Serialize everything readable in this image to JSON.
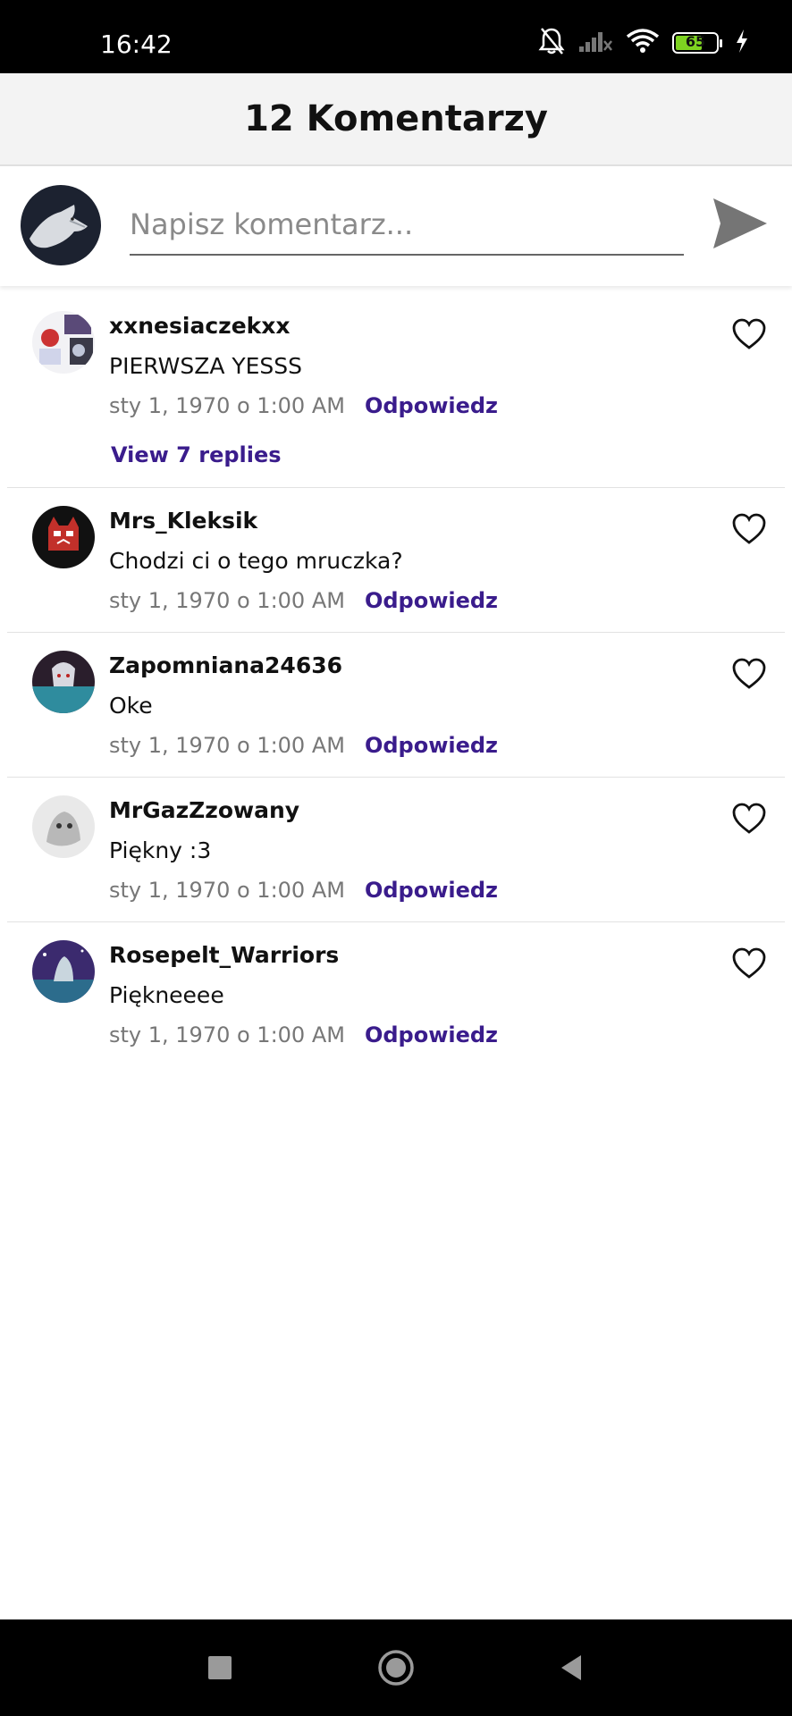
{
  "status_bar": {
    "time": "16:42",
    "battery": "65",
    "battery_fraction": 0.65,
    "icons": [
      "bell-off-icon",
      "signal-off-icon",
      "wifi-icon",
      "battery-icon",
      "charging-icon"
    ]
  },
  "header": {
    "title": "12 Komentarzy"
  },
  "composer": {
    "placeholder": "Napisz komentarz...",
    "send_icon": "send-icon"
  },
  "colors": {
    "accent": "#3a1c8c",
    "header_bg": "#f3f3f3",
    "meta_text": "#777777"
  },
  "comments": [
    {
      "author": "xxnesiaczekxx",
      "text": "PIERWSZA YESSS",
      "date": "sty 1, 1970 o 1:00 AM",
      "reply": "Odpowiedz",
      "view_replies": "View 7 replies"
    },
    {
      "author": "Mrs_Kleksik",
      "text": "Chodzi ci o tego mruczka?",
      "date": "sty 1, 1970 o 1:00 AM",
      "reply": "Odpowiedz"
    },
    {
      "author": "Zapomniana24636",
      "text": "Oke",
      "date": "sty 1, 1970 o 1:00 AM",
      "reply": "Odpowiedz"
    },
    {
      "author": "MrGazZzowany",
      "text": "Piękny :3",
      "date": "sty 1, 1970 o 1:00 AM",
      "reply": "Odpowiedz"
    },
    {
      "author": "Rosepelt_Warriors",
      "text": "Piękneeee",
      "date": "sty 1, 1970 o 1:00 AM",
      "reply": "Odpowiedz"
    }
  ],
  "nav": {
    "icons": [
      "recents-square-icon",
      "home-circle-icon",
      "back-triangle-icon"
    ]
  }
}
